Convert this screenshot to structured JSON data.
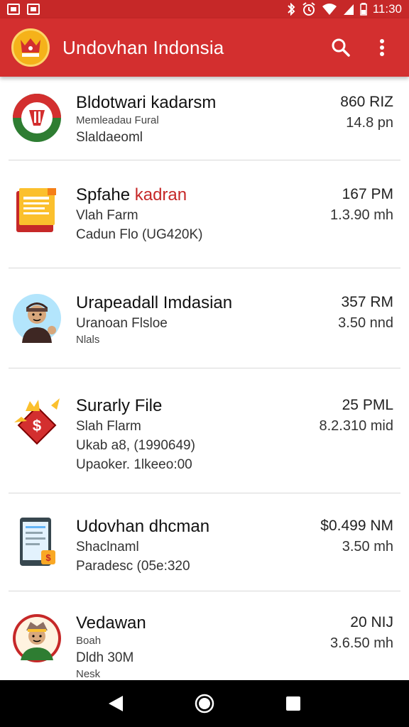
{
  "status_bar": {
    "time": "11:30",
    "icons": [
      "image-icon",
      "message-icon",
      "bluetooth-icon",
      "alarm-icon",
      "wifi-icon",
      "signal-icon",
      "battery-icon"
    ]
  },
  "app_bar": {
    "title": "Undovhan Indonsia",
    "icons": [
      "app-logo-icon",
      "search-icon",
      "more-vert-icon"
    ],
    "colors": {
      "primary": "#d32f2f",
      "status": "#c62828"
    }
  },
  "list": {
    "items": [
      {
        "title": "Bldotwari kadarsm",
        "line1": "Memleadau Fural",
        "line2": "Slaldaeoml",
        "meta1": "860 RIZ",
        "meta2": "14.8 pn",
        "icon": "red-green-badge-icon"
      },
      {
        "title_prefix": "Spfahe ",
        "title_accent": "kadran",
        "line1": "Vlah Farm",
        "line2": "Cadun Flo (UG420K)",
        "meta1": "167 PM",
        "meta2": "1.3.90 mh",
        "icon": "folder-document-icon"
      },
      {
        "title": "Urapeadall Imdasian",
        "line1": "Uranoan Flsloe",
        "line2": "Nlals",
        "meta1": "357 RM",
        "meta2": "3.50 nnd",
        "icon": "person-avatar-icon"
      },
      {
        "title": "Surarly File",
        "line1": "Slah Flarm",
        "line2": "Ukab a8, (1990649)",
        "line3": "Upaoker. 1lkeeo:00",
        "meta1": "25 PML",
        "meta2": "8.2.310 mid",
        "icon": "money-diamond-icon"
      },
      {
        "title": "Udovhan dhcman",
        "line1": "Shaclnaml",
        "line2": "Paradesc (05e:320",
        "meta1": "$0.499 NM",
        "meta2": "3.50 mh",
        "icon": "tablet-document-icon"
      },
      {
        "title": "Vedawan",
        "line1": "Boah",
        "line2": "Dldh 30M",
        "line3": "Nesk",
        "meta1": "20 NIJ",
        "meta2": "3.6.50 mh",
        "icon": "warrior-avatar-icon"
      }
    ]
  },
  "nav_bar": {
    "icons": [
      "back-triangle-icon",
      "home-circle-icon",
      "recents-square-icon"
    ]
  }
}
